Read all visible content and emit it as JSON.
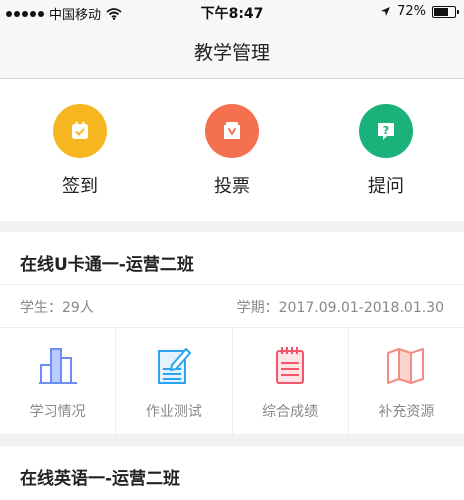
{
  "status_bar": {
    "carrier": "中国移动",
    "time": "下午8:47",
    "battery": "72%",
    "battery_level": 0.72
  },
  "header": {
    "title": "教学管理"
  },
  "actions": [
    {
      "label": "签到",
      "icon": "checkin-icon",
      "color": "#f6b620"
    },
    {
      "label": "投票",
      "icon": "vote-icon",
      "color": "#f4704e"
    },
    {
      "label": "提问",
      "icon": "question-icon",
      "color": "#1ab17a"
    }
  ],
  "classes": [
    {
      "title": "在线U卡通一-运营二班",
      "students": "学生：29人",
      "term": "学期：2017.09.01-2018.01.30",
      "tools": [
        {
          "label": "学习情况",
          "icon": "bar-chart-icon",
          "color": "#6a8ef3"
        },
        {
          "label": "作业测试",
          "icon": "homework-icon",
          "color": "#2aa3f1"
        },
        {
          "label": "综合成绩",
          "icon": "notebook-icon",
          "color": "#f0556a"
        },
        {
          "label": "补充资源",
          "icon": "map-icon",
          "color": "#f38b82"
        }
      ]
    },
    {
      "title": "在线英语一-运营二班"
    }
  ]
}
